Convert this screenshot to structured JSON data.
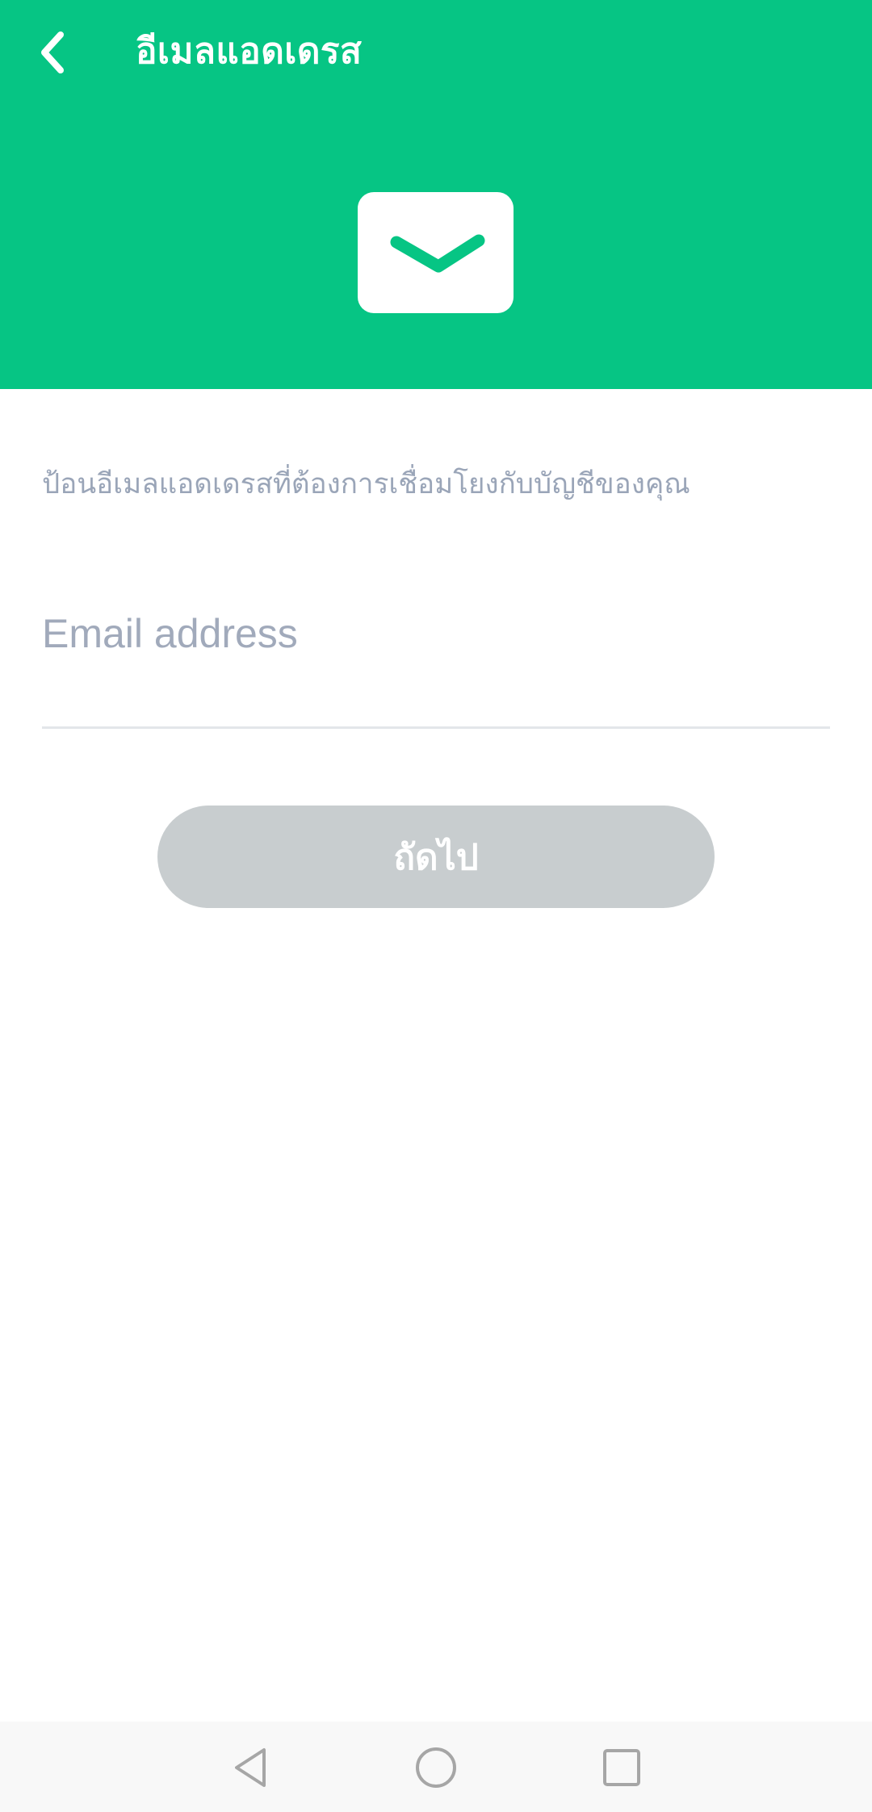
{
  "header": {
    "title": "อีเมลแอดเดรส",
    "back_icon": "chevron-left-icon",
    "mail_icon": "envelope-icon",
    "background": "#06c584"
  },
  "form": {
    "description": "ป้อนอีเมลแอดเดรสที่ต้องการเชื่อมโยงกับบัญชีของคุณ",
    "email": {
      "value": "",
      "placeholder": "Email address"
    },
    "next_label": "ถัดไป",
    "next_enabled": false,
    "next_button_color": "#c8cdcf"
  },
  "navbar": {
    "back_icon": "triangle-back-icon",
    "home_icon": "circle-home-icon",
    "recent_icon": "square-recents-icon"
  }
}
